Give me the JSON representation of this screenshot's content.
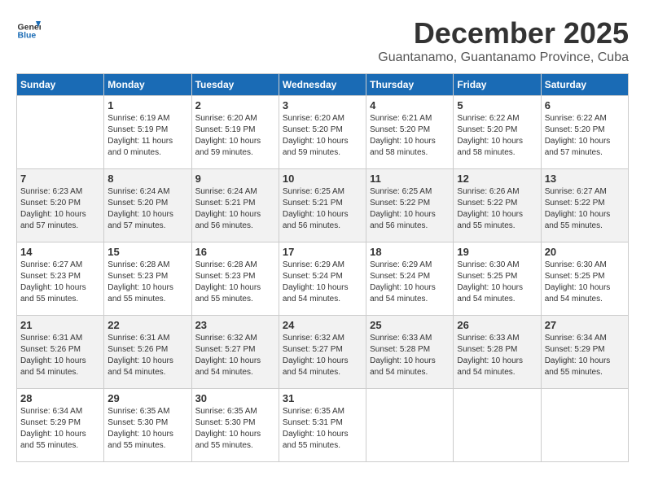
{
  "header": {
    "logo_general": "General",
    "logo_blue": "Blue",
    "month_year": "December 2025",
    "location": "Guantanamo, Guantanamo Province, Cuba"
  },
  "weekdays": [
    "Sunday",
    "Monday",
    "Tuesday",
    "Wednesday",
    "Thursday",
    "Friday",
    "Saturday"
  ],
  "weeks": [
    [
      {
        "day": "",
        "sunrise": "",
        "sunset": "",
        "daylight": ""
      },
      {
        "day": "1",
        "sunrise": "Sunrise: 6:19 AM",
        "sunset": "Sunset: 5:19 PM",
        "daylight": "Daylight: 11 hours and 0 minutes."
      },
      {
        "day": "2",
        "sunrise": "Sunrise: 6:20 AM",
        "sunset": "Sunset: 5:19 PM",
        "daylight": "Daylight: 10 hours and 59 minutes."
      },
      {
        "day": "3",
        "sunrise": "Sunrise: 6:20 AM",
        "sunset": "Sunset: 5:20 PM",
        "daylight": "Daylight: 10 hours and 59 minutes."
      },
      {
        "day": "4",
        "sunrise": "Sunrise: 6:21 AM",
        "sunset": "Sunset: 5:20 PM",
        "daylight": "Daylight: 10 hours and 58 minutes."
      },
      {
        "day": "5",
        "sunrise": "Sunrise: 6:22 AM",
        "sunset": "Sunset: 5:20 PM",
        "daylight": "Daylight: 10 hours and 58 minutes."
      },
      {
        "day": "6",
        "sunrise": "Sunrise: 6:22 AM",
        "sunset": "Sunset: 5:20 PM",
        "daylight": "Daylight: 10 hours and 57 minutes."
      }
    ],
    [
      {
        "day": "7",
        "sunrise": "Sunrise: 6:23 AM",
        "sunset": "Sunset: 5:20 PM",
        "daylight": "Daylight: 10 hours and 57 minutes."
      },
      {
        "day": "8",
        "sunrise": "Sunrise: 6:24 AM",
        "sunset": "Sunset: 5:20 PM",
        "daylight": "Daylight: 10 hours and 57 minutes."
      },
      {
        "day": "9",
        "sunrise": "Sunrise: 6:24 AM",
        "sunset": "Sunset: 5:21 PM",
        "daylight": "Daylight: 10 hours and 56 minutes."
      },
      {
        "day": "10",
        "sunrise": "Sunrise: 6:25 AM",
        "sunset": "Sunset: 5:21 PM",
        "daylight": "Daylight: 10 hours and 56 minutes."
      },
      {
        "day": "11",
        "sunrise": "Sunrise: 6:25 AM",
        "sunset": "Sunset: 5:22 PM",
        "daylight": "Daylight: 10 hours and 56 minutes."
      },
      {
        "day": "12",
        "sunrise": "Sunrise: 6:26 AM",
        "sunset": "Sunset: 5:22 PM",
        "daylight": "Daylight: 10 hours and 55 minutes."
      },
      {
        "day": "13",
        "sunrise": "Sunrise: 6:27 AM",
        "sunset": "Sunset: 5:22 PM",
        "daylight": "Daylight: 10 hours and 55 minutes."
      }
    ],
    [
      {
        "day": "14",
        "sunrise": "Sunrise: 6:27 AM",
        "sunset": "Sunset: 5:23 PM",
        "daylight": "Daylight: 10 hours and 55 minutes."
      },
      {
        "day": "15",
        "sunrise": "Sunrise: 6:28 AM",
        "sunset": "Sunset: 5:23 PM",
        "daylight": "Daylight: 10 hours and 55 minutes."
      },
      {
        "day": "16",
        "sunrise": "Sunrise: 6:28 AM",
        "sunset": "Sunset: 5:23 PM",
        "daylight": "Daylight: 10 hours and 55 minutes."
      },
      {
        "day": "17",
        "sunrise": "Sunrise: 6:29 AM",
        "sunset": "Sunset: 5:24 PM",
        "daylight": "Daylight: 10 hours and 54 minutes."
      },
      {
        "day": "18",
        "sunrise": "Sunrise: 6:29 AM",
        "sunset": "Sunset: 5:24 PM",
        "daylight": "Daylight: 10 hours and 54 minutes."
      },
      {
        "day": "19",
        "sunrise": "Sunrise: 6:30 AM",
        "sunset": "Sunset: 5:25 PM",
        "daylight": "Daylight: 10 hours and 54 minutes."
      },
      {
        "day": "20",
        "sunrise": "Sunrise: 6:30 AM",
        "sunset": "Sunset: 5:25 PM",
        "daylight": "Daylight: 10 hours and 54 minutes."
      }
    ],
    [
      {
        "day": "21",
        "sunrise": "Sunrise: 6:31 AM",
        "sunset": "Sunset: 5:26 PM",
        "daylight": "Daylight: 10 hours and 54 minutes."
      },
      {
        "day": "22",
        "sunrise": "Sunrise: 6:31 AM",
        "sunset": "Sunset: 5:26 PM",
        "daylight": "Daylight: 10 hours and 54 minutes."
      },
      {
        "day": "23",
        "sunrise": "Sunrise: 6:32 AM",
        "sunset": "Sunset: 5:27 PM",
        "daylight": "Daylight: 10 hours and 54 minutes."
      },
      {
        "day": "24",
        "sunrise": "Sunrise: 6:32 AM",
        "sunset": "Sunset: 5:27 PM",
        "daylight": "Daylight: 10 hours and 54 minutes."
      },
      {
        "day": "25",
        "sunrise": "Sunrise: 6:33 AM",
        "sunset": "Sunset: 5:28 PM",
        "daylight": "Daylight: 10 hours and 54 minutes."
      },
      {
        "day": "26",
        "sunrise": "Sunrise: 6:33 AM",
        "sunset": "Sunset: 5:28 PM",
        "daylight": "Daylight: 10 hours and 54 minutes."
      },
      {
        "day": "27",
        "sunrise": "Sunrise: 6:34 AM",
        "sunset": "Sunset: 5:29 PM",
        "daylight": "Daylight: 10 hours and 55 minutes."
      }
    ],
    [
      {
        "day": "28",
        "sunrise": "Sunrise: 6:34 AM",
        "sunset": "Sunset: 5:29 PM",
        "daylight": "Daylight: 10 hours and 55 minutes."
      },
      {
        "day": "29",
        "sunrise": "Sunrise: 6:35 AM",
        "sunset": "Sunset: 5:30 PM",
        "daylight": "Daylight: 10 hours and 55 minutes."
      },
      {
        "day": "30",
        "sunrise": "Sunrise: 6:35 AM",
        "sunset": "Sunset: 5:30 PM",
        "daylight": "Daylight: 10 hours and 55 minutes."
      },
      {
        "day": "31",
        "sunrise": "Sunrise: 6:35 AM",
        "sunset": "Sunset: 5:31 PM",
        "daylight": "Daylight: 10 hours and 55 minutes."
      },
      {
        "day": "",
        "sunrise": "",
        "sunset": "",
        "daylight": ""
      },
      {
        "day": "",
        "sunrise": "",
        "sunset": "",
        "daylight": ""
      },
      {
        "day": "",
        "sunrise": "",
        "sunset": "",
        "daylight": ""
      }
    ]
  ]
}
